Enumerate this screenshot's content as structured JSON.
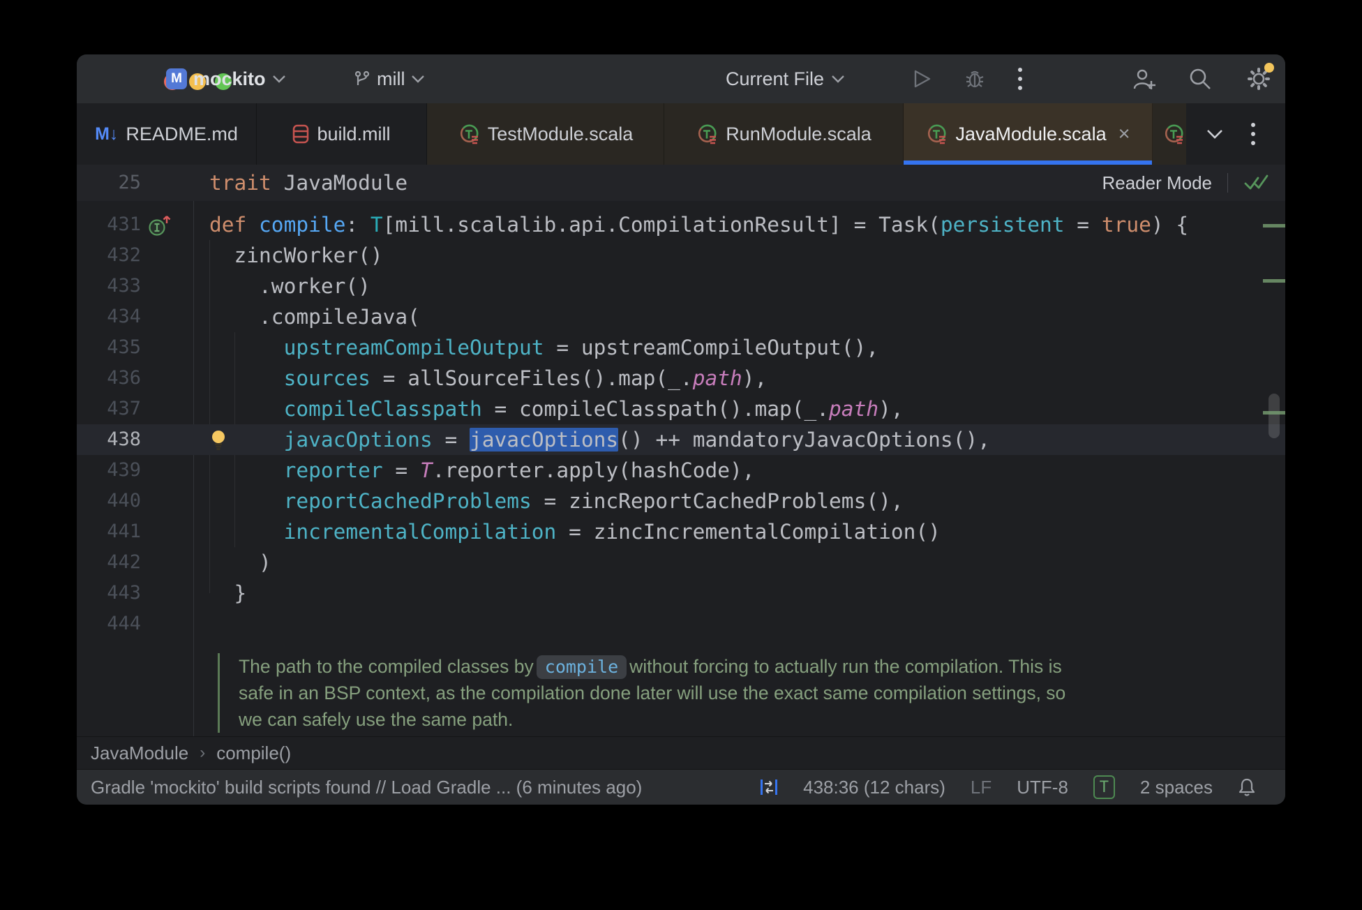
{
  "colors": {
    "accent_blue": "#3574f0",
    "traffic_red": "#ec6a5e",
    "traffic_yellow": "#f4bf4f",
    "traffic_green": "#62c554",
    "selection_blue": "#2e5cad",
    "notification_dot": "#f2c55c"
  },
  "titlebar": {
    "project_initial": "M",
    "project_name": "mockito",
    "branch_name": "mill",
    "run_config": "Current File"
  },
  "glyphs": {
    "markdown_icon": "M↓",
    "tab_close": "×"
  },
  "tabs": [
    {
      "label": "README.md",
      "icon": "markdown"
    },
    {
      "label": "build.mill",
      "icon": "mill-file"
    },
    {
      "label": "TestModule.scala",
      "icon": "scala-trait"
    },
    {
      "label": "RunModule.scala",
      "icon": "scala-trait"
    },
    {
      "label": "JavaModule.scala",
      "icon": "scala-trait",
      "active": true
    },
    {
      "label": "",
      "icon": "scala-trait"
    }
  ],
  "sticky": {
    "line_number": "25",
    "keyword": "trait ",
    "name": "JavaModule",
    "reader_mode_label": "Reader Mode"
  },
  "editor": {
    "lines": [
      {
        "num": "431",
        "gutter": "override",
        "tokens": [
          [
            "def ",
            "kw"
          ],
          [
            "compile",
            "fn"
          ],
          [
            ": ",
            "pl"
          ],
          [
            "T",
            "ty"
          ],
          [
            "[mill.scalalib.api.CompilationResult] = Task(",
            "pl"
          ],
          [
            "persistent",
            "na"
          ],
          [
            " = ",
            "pl"
          ],
          [
            "true",
            "kw"
          ],
          [
            ") {",
            "pl"
          ]
        ]
      },
      {
        "num": "432",
        "tokens": [
          [
            "  zincWorker()",
            "pl"
          ]
        ]
      },
      {
        "num": "433",
        "tokens": [
          [
            "    .worker()",
            "pl"
          ]
        ]
      },
      {
        "num": "434",
        "tokens": [
          [
            "    .compileJava(",
            "pl"
          ]
        ]
      },
      {
        "num": "435",
        "tokens": [
          [
            "      ",
            "pl"
          ],
          [
            "upstreamCompileOutput",
            "na"
          ],
          [
            " = upstreamCompileOutput(),",
            "pl"
          ]
        ]
      },
      {
        "num": "436",
        "tokens": [
          [
            "      ",
            "pl"
          ],
          [
            "sources",
            "na"
          ],
          [
            " = allSourceFiles().map(_.",
            "pl"
          ],
          [
            "path",
            "fi"
          ],
          [
            "),",
            "pl"
          ]
        ]
      },
      {
        "num": "437",
        "tokens": [
          [
            "      ",
            "pl"
          ],
          [
            "compileClasspath",
            "na"
          ],
          [
            " = compileClasspath().map(_.",
            "pl"
          ],
          [
            "path",
            "fi"
          ],
          [
            "),",
            "pl"
          ]
        ]
      },
      {
        "num": "438",
        "gutter": "bulb",
        "current": true,
        "tokens": [
          [
            "      ",
            "pl"
          ],
          [
            "javacOptions",
            "na"
          ],
          [
            " = ",
            "pl"
          ],
          [
            "javacOptions",
            "pl sel"
          ],
          [
            "() ++ mandatoryJavacOptions(),",
            "pl"
          ]
        ]
      },
      {
        "num": "439",
        "tokens": [
          [
            "      ",
            "pl"
          ],
          [
            "reporter",
            "na"
          ],
          [
            " = ",
            "pl"
          ],
          [
            "T",
            "fi"
          ],
          [
            ".reporter.apply(hashCode),",
            "pl"
          ]
        ]
      },
      {
        "num": "440",
        "tokens": [
          [
            "      ",
            "pl"
          ],
          [
            "reportCachedProblems",
            "na"
          ],
          [
            " = zincReportCachedProblems(),",
            "pl"
          ]
        ]
      },
      {
        "num": "441",
        "tokens": [
          [
            "      ",
            "pl"
          ],
          [
            "incrementalCompilation",
            "na"
          ],
          [
            " = zincIncrementalCompilation()",
            "pl"
          ]
        ]
      },
      {
        "num": "442",
        "tokens": [
          [
            "    )",
            "pl"
          ]
        ]
      },
      {
        "num": "443",
        "tokens": [
          [
            "  }",
            "pl"
          ]
        ]
      },
      {
        "num": "444",
        "tokens": []
      }
    ],
    "doc": {
      "line1_pre": "The path to the compiled classes by",
      "chip": "compile",
      "line1_post": "without forcing to actually run the compilation. This is",
      "line2": "safe in an BSP context, as the compilation done later will use the exact same compilation settings, so",
      "line3": "we can safely use the same path."
    }
  },
  "breadcrumbs": {
    "items": [
      "JavaModule",
      "compile()"
    ],
    "separator": "›"
  },
  "statusbar": {
    "message": "Gradle 'mockito' build scripts found // Load Gradle ... (6 minutes ago)",
    "caret_position": "438:36 (12 chars)",
    "line_separator": "LF",
    "encoding": "UTF-8",
    "highlighting_indicator": "T",
    "indent_config": "2 spaces"
  }
}
